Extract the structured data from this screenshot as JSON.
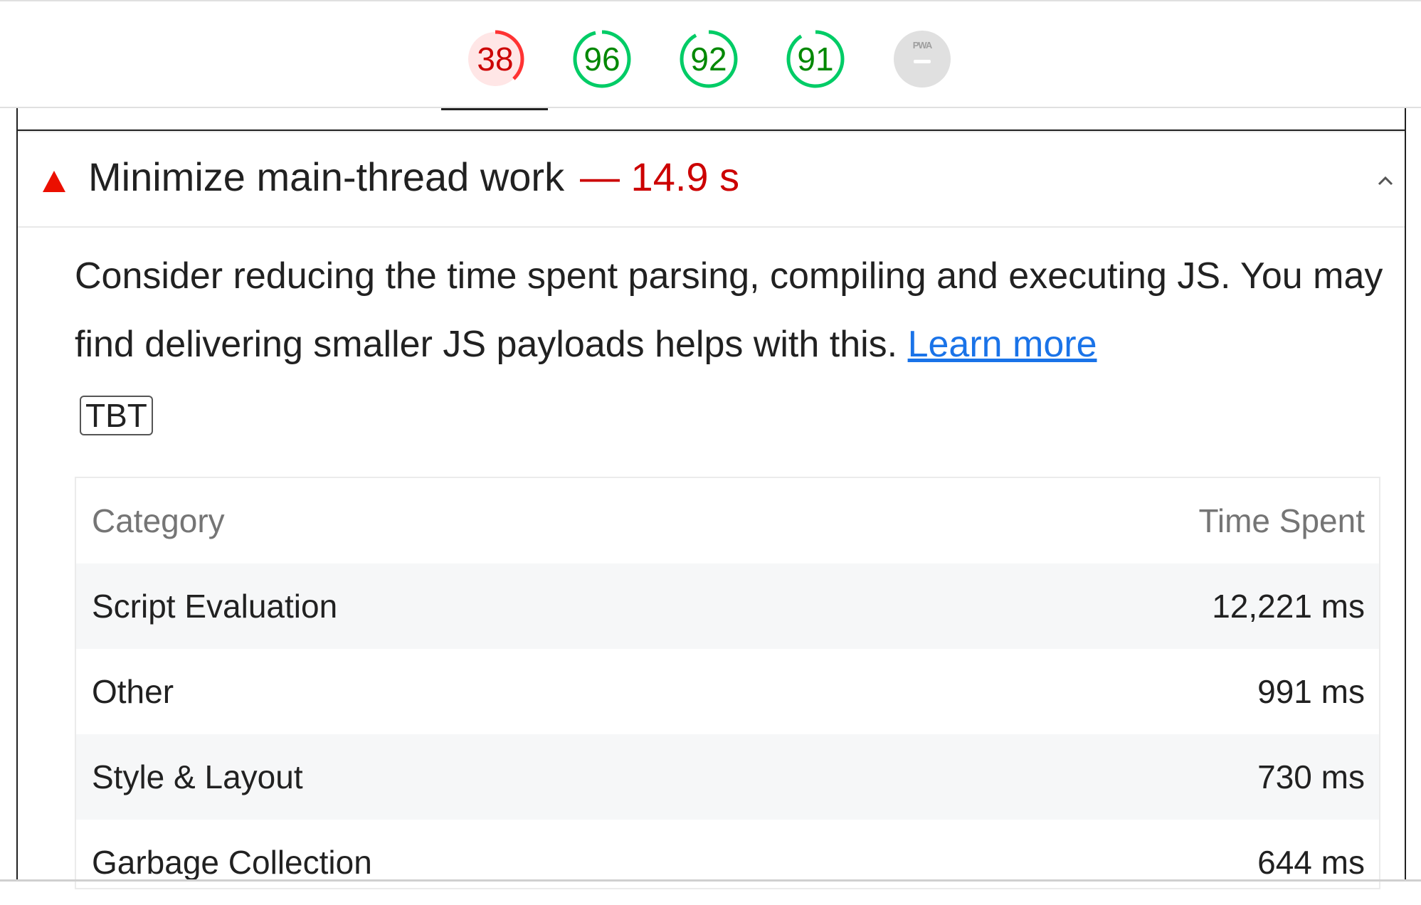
{
  "scores": [
    {
      "label": "38",
      "value": 38,
      "status": "fail",
      "color": "#cc0000",
      "ring": "#ff3333",
      "fill": "#ffe6e6",
      "active": true
    },
    {
      "label": "96",
      "value": 96,
      "status": "pass",
      "color": "#008800",
      "ring": "#00cc66",
      "fill": "#ffffff",
      "active": false
    },
    {
      "label": "92",
      "value": 92,
      "status": "pass",
      "color": "#008800",
      "ring": "#00cc66",
      "fill": "#ffffff",
      "active": false
    },
    {
      "label": "91",
      "value": 91,
      "status": "pass",
      "color": "#008800",
      "ring": "#00cc66",
      "fill": "#ffffff",
      "active": false
    }
  ],
  "pwa_badge": {
    "label": "PWA",
    "color": "#e0e0e0"
  },
  "audit": {
    "icon": "fail-triangle-icon",
    "title": "Minimize main-thread work",
    "value": "— 14.9 s",
    "description": "Consider reducing the time spent parsing, compiling and executing JS. You may find delivering smaller JS payloads helps with this.",
    "learn_more": "Learn more",
    "badge": "TBT",
    "expanded_icon": "chevron-up-icon"
  },
  "table": {
    "headers": [
      "Category",
      "Time Spent"
    ],
    "rows": [
      [
        "Script Evaluation",
        "12,221 ms"
      ],
      [
        "Other",
        "991 ms"
      ],
      [
        "Style & Layout",
        "730 ms"
      ],
      [
        "Garbage Collection",
        "644 ms"
      ]
    ]
  }
}
